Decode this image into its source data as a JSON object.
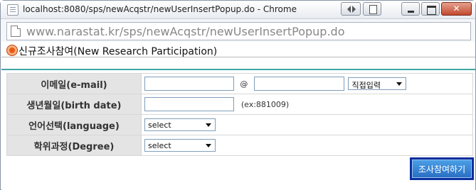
{
  "window": {
    "title": "localhost:8080/sps/newAcqstr/newUserInsertPopup.do - Chrome"
  },
  "address_bar": {
    "url": "www.narastat.kr/sps/newAcqstr/newUserInsertPopup.do"
  },
  "page": {
    "heading": "신규조사참여(New Research Participation)",
    "form": {
      "email_label": "이메일(e-mail)",
      "email_local_value": "",
      "email_at": "@",
      "email_domain_value": "",
      "email_domain_select": "직접입력",
      "birth_label": "생년월일(birth date)",
      "birth_value": "",
      "birth_hint": "(ex:881009)",
      "language_label": "언어선택(language)",
      "language_select": "select",
      "degree_label": "학위과정(Degree)",
      "degree_select": "select"
    },
    "submit_label": "조사참여하기"
  }
}
